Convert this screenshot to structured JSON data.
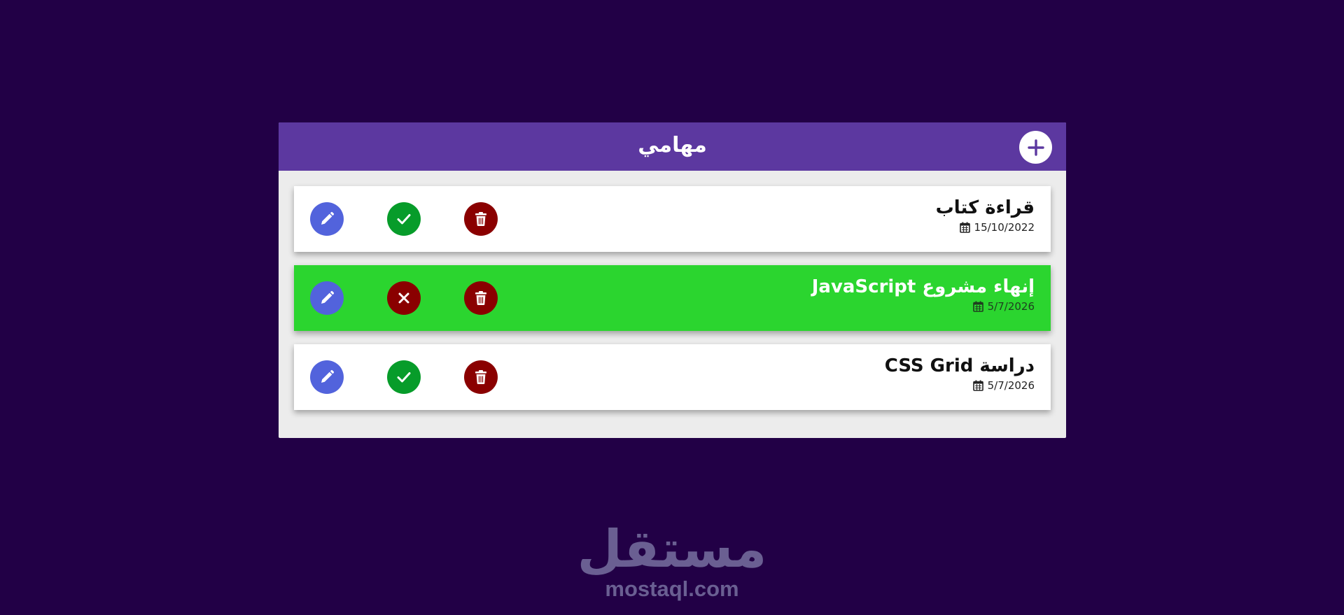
{
  "header": {
    "title": "مهامي",
    "add_icon": "plus-icon"
  },
  "tasks": [
    {
      "title": "قراءة كتاب",
      "date": "15/10/2022",
      "completed": false,
      "toggle_icon": "check-icon"
    },
    {
      "title": "إنهاء مشروع JavaScript",
      "date": "5/7/2026",
      "completed": true,
      "toggle_icon": "close-icon"
    },
    {
      "title": "دراسة CSS Grid",
      "date": "5/7/2026",
      "completed": false,
      "toggle_icon": "check-icon"
    }
  ],
  "colors": {
    "background": "#220046",
    "header": "#5c38a0",
    "completed_task": "#2bd52f",
    "edit_button": "#5263dc",
    "complete_button": "#079c2a",
    "delete_button": "#8a0000"
  },
  "watermark": {
    "logo_text": "مستقل",
    "url": "mostaql.com"
  }
}
